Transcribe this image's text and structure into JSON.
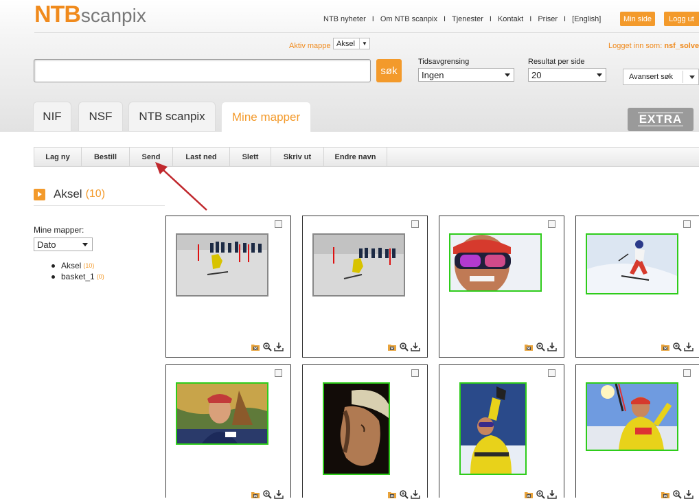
{
  "brand": {
    "ntb": "NTB",
    "scanpix": "scanpix"
  },
  "topnav": {
    "links": [
      "NTB nyheter",
      "Om NTB scanpix",
      "Tjenester",
      "Kontakt",
      "Priser",
      "[English]"
    ],
    "separator": "I",
    "min_side": "Min side",
    "logg_ut": "Logg ut"
  },
  "aktiv_mappe": {
    "label": "Aktiv mappe",
    "value": "Aksel"
  },
  "logged_in": {
    "prefix": "Logget inn som:",
    "user": "nsf_solve"
  },
  "search": {
    "value": "",
    "button": "søk"
  },
  "filters": {
    "tids_label": "Tidsavgrensing",
    "tids_value": "Ingen",
    "res_label": "Resultat per side",
    "res_value": "20",
    "advanced": "Avansert søk"
  },
  "tabs": [
    {
      "label": "NIF",
      "active": false
    },
    {
      "label": "NSF",
      "active": false
    },
    {
      "label": "NTB scanpix",
      "active": false
    },
    {
      "label": "Mine mapper",
      "active": true
    }
  ],
  "extra_badge": "EXTRA",
  "toolbar": [
    "Lag ny",
    "Bestill",
    "Send",
    "Last ned",
    "Slett",
    "Skriv ut",
    "Endre navn"
  ],
  "folder": {
    "name": "Aksel",
    "count": "(10)"
  },
  "sidebar": {
    "label": "Mine mapper:",
    "sort_value": "Dato",
    "folders": [
      {
        "name": "Aksel",
        "count": "(10)"
      },
      {
        "name": "basket_1",
        "count": "(0)"
      }
    ]
  },
  "colors": {
    "accent": "#f39a2b",
    "selected_border": "#2ecc1a",
    "arrow": "#c0282d"
  },
  "photos": [
    {
      "name": "slalom-gate-1",
      "selected": false
    },
    {
      "name": "slalom-gate-2",
      "selected": false
    },
    {
      "name": "skier-goggles-closeup",
      "selected": true
    },
    {
      "name": "skier-turning",
      "selected": true
    },
    {
      "name": "portrait-outdoor",
      "selected": true
    },
    {
      "name": "portrait-profile",
      "selected": true
    },
    {
      "name": "skier-yellow-suit",
      "selected": true
    },
    {
      "name": "skier-celebrating",
      "selected": true
    }
  ]
}
